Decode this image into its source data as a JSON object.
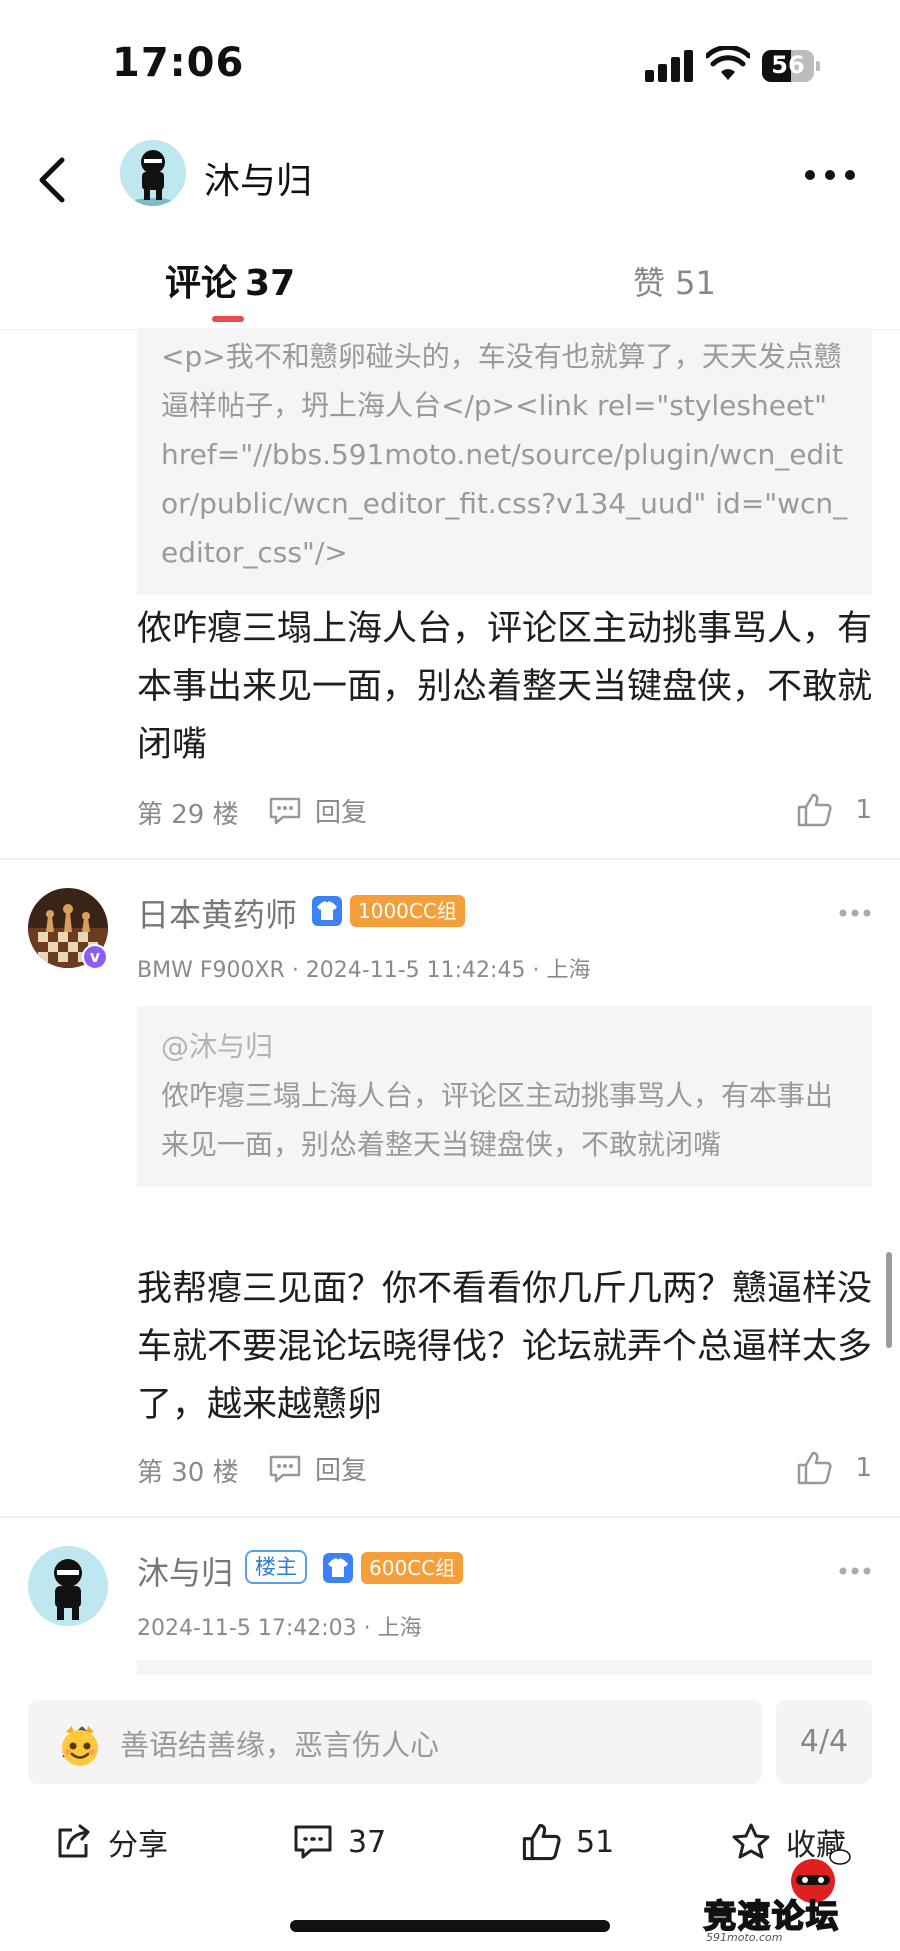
{
  "status_bar": {
    "time": "17:06",
    "battery": "56",
    "battery_level": 0.56
  },
  "header": {
    "title": "沐与归"
  },
  "tabs": {
    "comments_label": "评论",
    "comments_count": "37",
    "likes_label": "赞 51"
  },
  "comments": [
    {
      "quote_text": "<p>我不和戆卵碰头的，车没有也就算了，天天发点戆逼样帖子，坍上海人台</p><link rel=\"stylesheet\" href=\"//bbs.591moto.net/source/plugin/wcn_editor/public/wcn_editor_fit.css?v134_uud\" id=\"wcn_editor_css\"/>",
      "text": "侬咋瘪三塌上海人台，评论区主动挑事骂人，有本事出来见一面，别怂着整天当键盘侠，不敢就闭嘴",
      "floor": "第 29 楼",
      "reply_label": "回复",
      "likes": "1"
    },
    {
      "author": "日本黄药师",
      "group_badge": "1000CC组",
      "subline": "BMW F900XR · 2024-11-5 11:42:45 · 上海",
      "quote_at": "@沐与归",
      "quote_text": "侬咋瘪三塌上海人台，评论区主动挑事骂人，有本事出来见一面，别怂着整天当键盘侠，不敢就闭嘴",
      "text": "我帮瘪三见面？你不看看你几斤几两？戆逼样没车就不要混论坛晓得伐？论坛就弄个总逼样太多了，越来越戆卵",
      "floor": "第 30 楼",
      "reply_label": "回复",
      "likes": "1"
    },
    {
      "author": "沐与归",
      "owner_badge": "楼主",
      "group_badge": "600CC组",
      "subline": "2024-11-5 17:42:03 · 上海"
    }
  ],
  "input": {
    "placeholder": "善语结善缘，恶言伤人心",
    "page_indicator": "4/4"
  },
  "actions": {
    "share_label": "分享",
    "comments_count": "37",
    "likes_count": "51",
    "favorite_label": "收藏"
  },
  "watermark": {
    "text_black_1": "竞",
    "text_red": "速",
    "text_black_2": "论坛",
    "site": "591moto.com"
  },
  "colors": {
    "accent": "#e94b4b",
    "group_badge": "#f59f3a",
    "shirt_badge": "#3b82f6",
    "owner_badge": "#2f7fd0",
    "verified": "#8b5cf6"
  }
}
